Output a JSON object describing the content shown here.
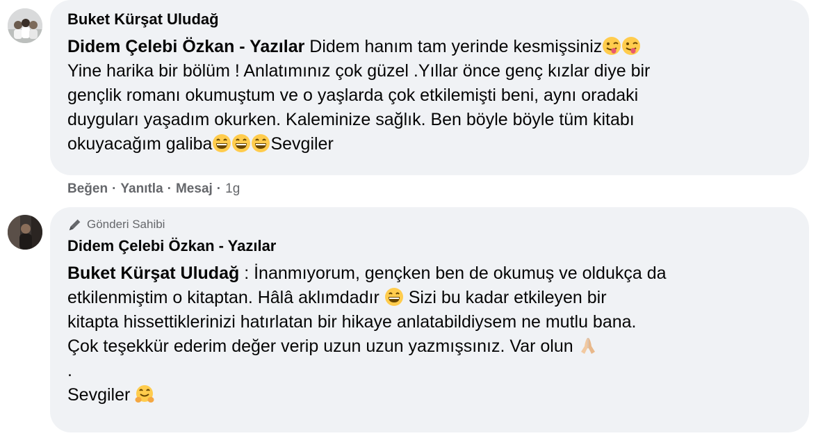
{
  "comments": [
    {
      "author": "Buket Kürşat Uludağ",
      "mention": "Didem Çelebi Özkan - Yazılar",
      "text_line1": " Didem hanım tam yerinde kesmişsiniz",
      "line2": "Yine harika bir bölüm ! Anlatımınız çok güzel .Yıllar önce genç kızlar diye bir",
      "line3": "gençlik romanı okumuştum ve o yaşlarda çok etkilemişti beni, aynı oradaki",
      "line4": "duyguları yaşadım okurken. Kaleminize sağlık. Ben böyle böyle tüm kitabı",
      "line5_start": "okuyacağım galiba",
      "line5_end": "Sevgiler",
      "actions": {
        "like": "Beğen",
        "reply": "Yanıtla",
        "message": "Mesaj",
        "time": "1g"
      },
      "emojis": [
        "winking-tongue-emoji",
        "grinning-emoji"
      ]
    },
    {
      "badge": "Gönderi Sahibi",
      "author": "Didem Çelebi Özkan - Yazılar",
      "mention": "Buket Kürşat Uludağ",
      "line1_rest": " : İnanmıyorum, gençken ben de okumuş ve oldukça da",
      "line2_start": "etkilenmiştim o kitaptan. Hâlâ aklımdadır ",
      "line2_end": " Sizi bu kadar etkileyen bir",
      "line3": "kitapta hissettiklerinizi hatırlatan bir hikaye anlatabildiysem ne mutlu bana.",
      "line4": "Çok teşekkür ederim değer verip uzun uzun yazmışsınız. Var olun ",
      "line5": ".",
      "line6": "Sevgiler ",
      "emojis": [
        "grinning-emoji",
        "folded-hands-emoji",
        "hugging-face-emoji"
      ]
    }
  ],
  "colors": {
    "bubble": "#f0f2f5",
    "meta": "#65676b",
    "text": "#050505",
    "emoji_yellow": "#ffcc4d"
  }
}
